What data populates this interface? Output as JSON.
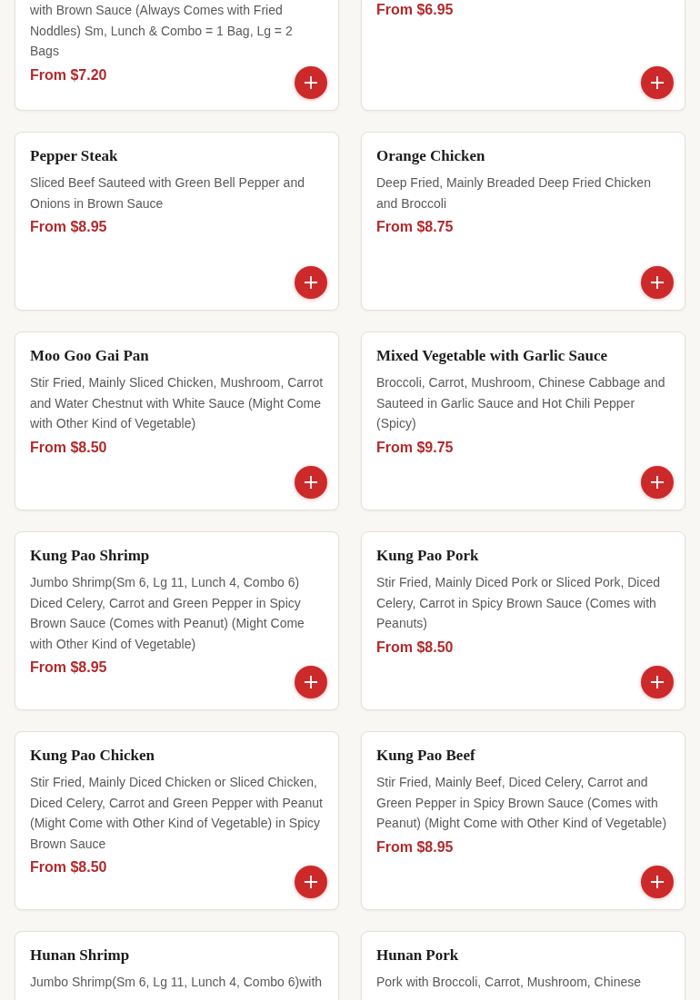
{
  "menu_items": [
    {
      "description": "with Brown Sauce (Always Comes with Fried Noddles) Sm, Lunch & Combo = 1 Bag, Lg = 2 Bags",
      "price": "From $7.20"
    },
    {
      "price": "From $6.95"
    },
    {
      "title": "Pepper Steak",
      "description": "Sliced Beef Sauteed with Green Bell Pepper and Onions in Brown Sauce",
      "price": "From $8.95"
    },
    {
      "title": "Orange Chicken",
      "description": "Deep Fried, Mainly Breaded Deep Fried Chicken and Broccoli",
      "price": "From $8.75"
    },
    {
      "title": "Moo Goo Gai Pan",
      "description": "Stir Fried, Mainly Sliced Chicken, Mushroom, Carrot and Water Chestnut with White Sauce (Might Come with Other Kind of Vegetable)",
      "price": "From $8.50"
    },
    {
      "title": "Mixed Vegetable with Garlic Sauce",
      "description": "Broccoli, Carrot, Mushroom, Chinese Cabbage and Sauteed in Garlic Sauce and Hot Chili Pepper (Spicy)",
      "price": "From $9.75"
    },
    {
      "title": "Kung Pao Shrimp",
      "description": "Jumbo Shrimp(Sm 6, Lg 11, Lunch 4, Combo 6) Diced Celery, Carrot and Green Pepper in Spicy Brown Sauce (Comes with Peanut) (Might Come with Other Kind of Vegetable)",
      "price": "From $8.95"
    },
    {
      "title": "Kung Pao Pork",
      "description": "Stir Fried, Mainly Diced Pork or Sliced Pork, Diced Celery, Carrot in Spicy Brown Sauce (Comes with Peanuts)",
      "price": "From $8.50"
    },
    {
      "title": "Kung Pao Chicken",
      "description": "Stir Fried, Mainly Diced Chicken or Sliced Chicken, Diced Celery, Carrot and Green Pepper with Peanut (Might Come with Other Kind of Vegetable) in Spicy Brown Sauce",
      "price": "From $8.50"
    },
    {
      "title": "Kung Pao Beef",
      "description": "Stir Fried, Mainly Beef, Diced Celery, Carrot and Green Pepper in Spicy Brown Sauce (Comes with Peanut) (Might Come with Other Kind of Vegetable)",
      "price": "From $8.95"
    },
    {
      "title": "Hunan Shrimp",
      "description": "Jumbo Shrimp(Sm 6, Lg 11, Lunch 4, Combo 6)with"
    },
    {
      "title": "Hunan Pork",
      "description": "Pork with Broccoli, Carrot, Mushroom, Chinese"
    }
  ]
}
